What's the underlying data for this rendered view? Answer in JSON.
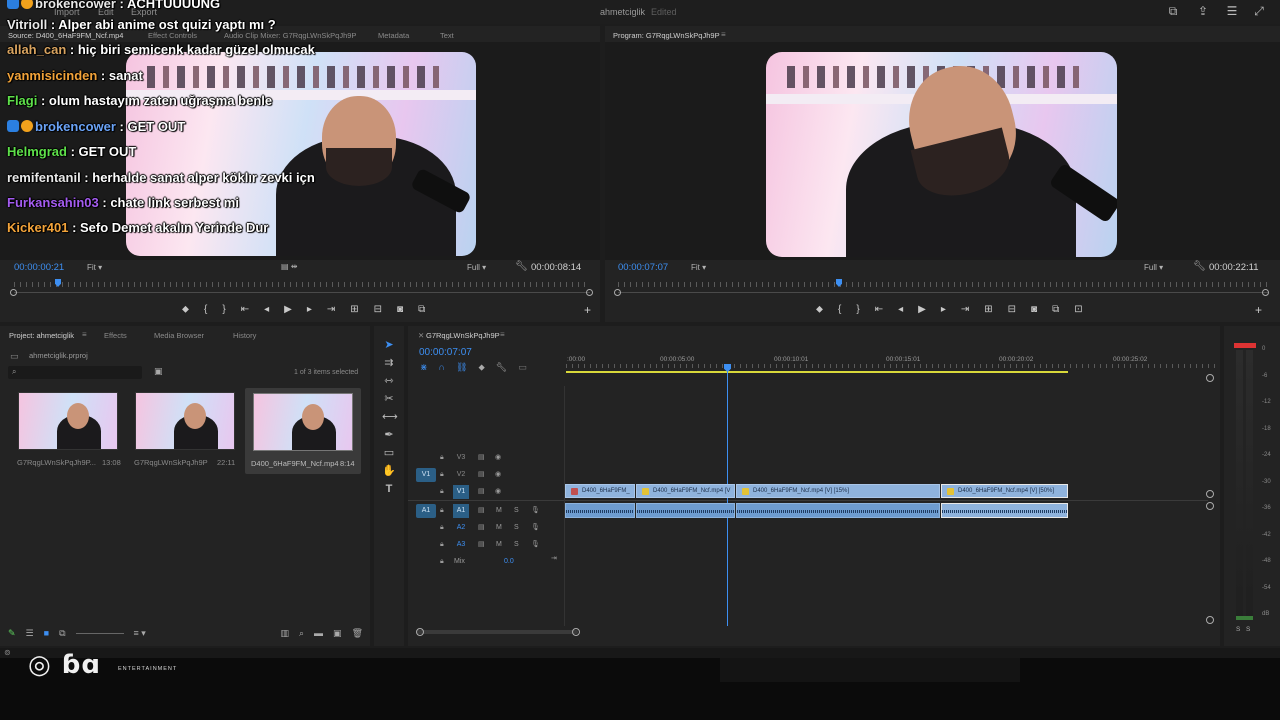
{
  "menubar": {
    "items": [
      "Import",
      "Edit",
      "Export"
    ],
    "project_title": "ahmetciglik",
    "edited_label": "Edited"
  },
  "source_monitor": {
    "tabs": [
      "Source: D400_6HaF9FM_Ncf.mp4",
      "Effect Controls",
      "Audio Clip Mixer: G7RqgLWnSkPqJh9P",
      "Metadata",
      "Text"
    ],
    "timecode": "00:00:00:21",
    "fit": "Fit",
    "full": "Full",
    "duration": "00:00:08:14"
  },
  "program_monitor": {
    "tab": "Program: G7RqgLWnSkPqJh9P",
    "timecode": "00:00:07:07",
    "fit": "Fit",
    "full": "Full",
    "duration": "00:00:22:11",
    "playhead_position": 0.34
  },
  "chat": [
    {
      "user": "brokencower",
      "message": "ACHTUUUUNG",
      "color": "#e8e8e8",
      "badges": true
    },
    {
      "user": "Vitrioll",
      "message": "Alper abi anime ost quizi yaptı mı ?",
      "color": "#e8e8e8",
      "badges": false
    },
    {
      "user": "allah_can",
      "message": "hiç biri semicenk kadar güzel olmucak",
      "color": "#d9a460",
      "badges": false
    },
    {
      "user": "yanmisicinden",
      "message": "sanat",
      "color": "#f2a33a",
      "badges": false
    },
    {
      "user": "Flagi",
      "message": "olum hastayım zaten uğraşma benle",
      "color": "#5ee04a",
      "badges": false
    },
    {
      "user": "brokencower",
      "message": "GET OUT",
      "color": "#6aa2f5",
      "badges": true
    },
    {
      "user": "Helmgrad",
      "message": "GET OUT",
      "color": "#5ee04a",
      "badges": false
    },
    {
      "user": "remifentanil",
      "message": "herhalde sanat alper köklır zevki içn",
      "color": "#e8e8e8",
      "badges": false
    },
    {
      "user": "Furkansahin03",
      "message": "chate link serbest mi",
      "color": "#a45cf0",
      "badges": false
    },
    {
      "user": "Kicker401",
      "message": "Sefo Demet akalın Yerinde Dur",
      "color": "#f2a33a",
      "badges": false
    }
  ],
  "project_panel": {
    "tabs": [
      "Project: ahmetciglik",
      "Effects",
      "Media Browser",
      "History"
    ],
    "file": "ahmetciglik.prproj",
    "selection": "1 of 3 items selected",
    "items": [
      {
        "name": "G7RqgLWnSkPqJh9P...",
        "duration": "13:08"
      },
      {
        "name": "G7RqgLWnSkPqJh9P",
        "duration": "22:11"
      },
      {
        "name": "D400_6HaF9FM_Ncf.mp4",
        "duration": "8:14"
      }
    ]
  },
  "timeline": {
    "tab": "G7RqgLWnSkPqJh9P",
    "timecode": "00:00:07:07",
    "ruler": [
      ":00:00",
      "00:00:05:00",
      "00:00:10:01",
      "00:00:15:01",
      "00:00:20:02",
      "00:00:25:02"
    ],
    "tracks": {
      "video": [
        "V3",
        "V2",
        "V1"
      ],
      "audio": [
        "A1",
        "A2",
        "A3"
      ],
      "target_v": "V1",
      "target_a": "A1",
      "mix_label": "Mix",
      "mix_value": "0.0"
    },
    "clips": [
      "D400_6HaF9FM_",
      "D400_6HaF9FM_Ncf.mp4 [V",
      "D400_6HaF9FM_Ncf.mp4 [V] [15%]",
      "D400_6HaF9FM_Ncf.mp4 [V] [50%]"
    ]
  },
  "meters": {
    "ticks": [
      "0",
      "-6",
      "-12",
      "-18",
      "-24",
      "-30",
      "-36",
      "-42",
      "-48",
      "-54",
      "dB"
    ],
    "solo": [
      "S",
      "S"
    ]
  },
  "watermark": {
    "sub": "ENTERTAINMENT"
  }
}
